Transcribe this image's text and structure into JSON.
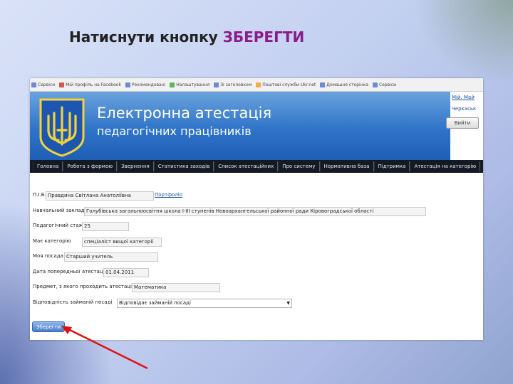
{
  "slide": {
    "title_prefix": "Натиснути кнопку ",
    "title_highlight": "ЗБЕРЕГТИ"
  },
  "bookmarks": [
    "Сервіси",
    "Мій профіль на Facebook",
    "Рекомендовані",
    "Налаштування",
    "Зі заголовком",
    "Поштові служби Ukr.net",
    "Домашня сторінка",
    "Сервіси"
  ],
  "banner": {
    "title": "Електронна атестація",
    "subtitle": "педагогічних працівників",
    "user_link": "Мій. Май",
    "user_place": "Черкаськ",
    "logout_label": "Вийти"
  },
  "nav": [
    "Головна",
    "Робота з формою",
    "Звернення",
    "Статистика заходів",
    "Список атестаційних",
    "Про систему",
    "Нормативна база",
    "Підтримка",
    "Атестація на категорію"
  ],
  "form": {
    "fio": {
      "label": "П.І.Б.",
      "value": "Правдина Світлана Анатоліївна",
      "portfolio": "Портфоліо"
    },
    "school": {
      "label": "Навчальний заклад",
      "value": "Голубівська загальноосвітня школа І-ІІІ ступенів Новоархангельської районної ради Кіровоградської області"
    },
    "stazh": {
      "label": "Педагогічний стаж",
      "value": "25"
    },
    "category": {
      "label": "Має категорію",
      "value": "спеціаліст вищої категорії"
    },
    "position": {
      "label": "Моя посада",
      "value": "Старший учитель"
    },
    "last_att": {
      "label": "Дата попередньої атестації",
      "value": "01.04.2011"
    },
    "subject": {
      "label": "Предмет, з якого проходить атестацію",
      "value": "Математика"
    },
    "rank": {
      "label": "Відповідність займаній посаді",
      "value": "Відповідає займаній посаді"
    },
    "save_label": "Зберегти"
  }
}
